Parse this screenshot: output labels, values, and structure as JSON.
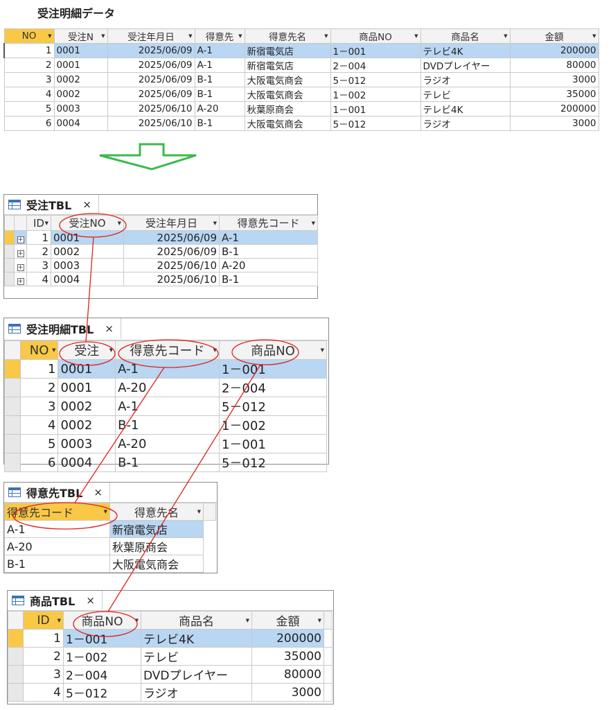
{
  "title": "受注明細データ",
  "top_table": {
    "headers": [
      "NO",
      "受注N",
      "受注年月日",
      "得意先",
      "得意先名",
      "商品NO",
      "商品名",
      "金額"
    ],
    "rows": [
      [
        "1",
        "0001",
        "2025/06/09",
        "A-1",
        "新宿電気店",
        "1－001",
        "テレビ4K",
        "200000"
      ],
      [
        "2",
        "0001",
        "2025/06/09",
        "A-1",
        "新宿電気店",
        "2－004",
        "DVDプレイヤー",
        "80000"
      ],
      [
        "3",
        "0002",
        "2025/06/09",
        "B-1",
        "大阪電気商会",
        "5－012",
        "ラジオ",
        "3000"
      ],
      [
        "4",
        "0002",
        "2025/06/09",
        "B-1",
        "大阪電気商会",
        "1－002",
        "テレビ",
        "35000"
      ],
      [
        "5",
        "0003",
        "2025/06/10",
        "A-20",
        "秋葉原商会",
        "1－001",
        "テレビ4K",
        "200000"
      ],
      [
        "6",
        "0004",
        "2025/06/10",
        "B-1",
        "大阪電気商会",
        "5－012",
        "ラジオ",
        "3000"
      ]
    ]
  },
  "juchu_tbl": {
    "tab_label": "受注TBL",
    "close": "×",
    "headers": [
      "ID",
      "受注NO",
      "受注年月日",
      "得意先コード"
    ],
    "rows": [
      [
        "1",
        "0001",
        "2025/06/09",
        "A-1"
      ],
      [
        "2",
        "0002",
        "2025/06/09",
        "B-1"
      ],
      [
        "3",
        "0003",
        "2025/06/10",
        "A-20"
      ],
      [
        "4",
        "0004",
        "2025/06/10",
        "B-1"
      ]
    ]
  },
  "meisai_tbl": {
    "tab_label": "受注明細TBL",
    "close": "×",
    "headers": [
      "NO",
      "受注",
      "得意先コード",
      "商品NO"
    ],
    "rows": [
      [
        "1",
        "0001",
        "A-1",
        "1－001"
      ],
      [
        "2",
        "0001",
        "A-20",
        "2－004"
      ],
      [
        "3",
        "0002",
        "A-1",
        "5－012"
      ],
      [
        "4",
        "0002",
        "B-1",
        "1－002"
      ],
      [
        "5",
        "0003",
        "A-20",
        "1－001"
      ],
      [
        "6",
        "0004",
        "B-1",
        "5－012"
      ]
    ]
  },
  "tokui_tbl": {
    "tab_label": "得意先TBL",
    "close": "×",
    "headers": [
      "得意先コード",
      "得意先名"
    ],
    "rows": [
      [
        "A-1",
        "新宿電気店"
      ],
      [
        "A-20",
        "秋葉原商会"
      ],
      [
        "B-1",
        "大阪電気商会"
      ]
    ]
  },
  "shohin_tbl": {
    "tab_label": "商品TBL",
    "close": "×",
    "headers": [
      "ID",
      "商品NO",
      "商品名",
      "金額"
    ],
    "rows": [
      [
        "1",
        "1－001",
        "テレビ4K",
        "200000"
      ],
      [
        "2",
        "1－002",
        "テレビ",
        "35000"
      ],
      [
        "3",
        "2－004",
        "DVDプレイヤー",
        "80000"
      ],
      [
        "4",
        "5－012",
        "ラジオ",
        "3000"
      ]
    ]
  },
  "colors": {
    "selected_row": "#b9d6f2",
    "header_highlight": "#f9c846",
    "annotation_red": "#e0201c",
    "arrow_green": "#3cb94a"
  }
}
